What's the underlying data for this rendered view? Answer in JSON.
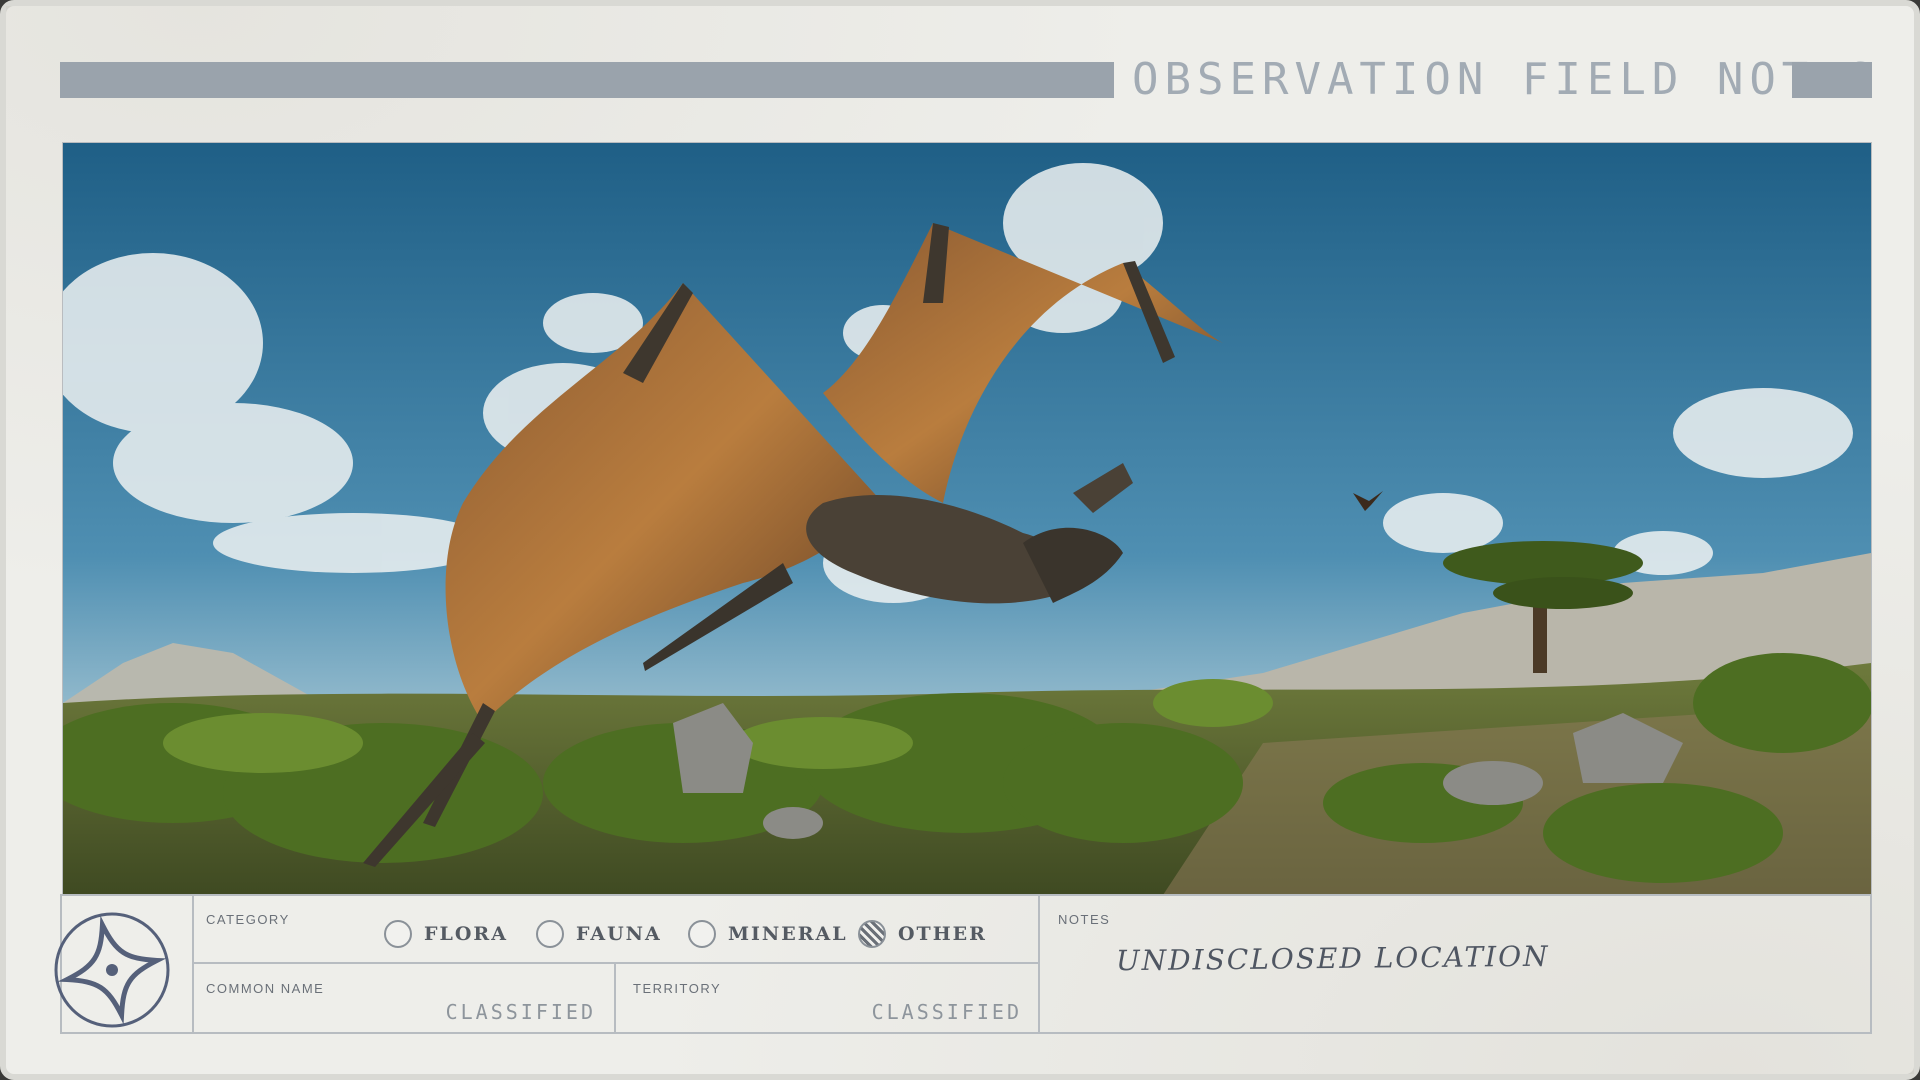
{
  "header": {
    "title": "OBSERVATION FIELD NOTES"
  },
  "photo": {
    "subject": "winged-creature"
  },
  "form": {
    "category_label": "CATEGORY",
    "categories": [
      {
        "label": "FLORA",
        "selected": false
      },
      {
        "label": "FAUNA",
        "selected": false
      },
      {
        "label": "MINERAL",
        "selected": false
      },
      {
        "label": "OTHER",
        "selected": true
      }
    ],
    "common_name_label": "COMMON NAME",
    "common_name_value": "CLASSIFIED",
    "territory_label": "TERRITORY",
    "territory_value": "CLASSIFIED",
    "notes_label": "NOTES",
    "notes_value": "UNDISCLOSED LOCATION"
  },
  "emblem": {
    "icon": "star-compass-emblem-icon"
  },
  "colors": {
    "paper": "#eeeeea",
    "accent_bar": "#9aa3ac",
    "sky": "#2f6e95",
    "ink": "#4f5662"
  }
}
